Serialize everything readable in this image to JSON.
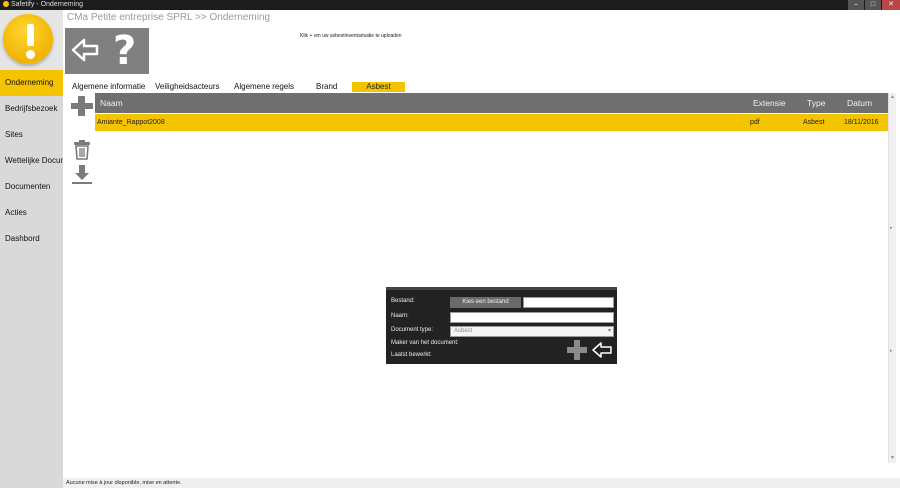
{
  "window": {
    "title": "Safetify - Onderneming"
  },
  "breadcrumb": "CMa Petite entreprise SPRL >> Onderneming",
  "hint": "Klik + om uw asbestinventarisatie te uploaden",
  "sidebar": {
    "items": [
      {
        "label": "Onderneming",
        "active": true
      },
      {
        "label": "Bedrijfsbezoek",
        "active": false
      },
      {
        "label": "Sites",
        "active": false
      },
      {
        "label": "Wettelijke Documenten",
        "active": false
      },
      {
        "label": "Documenten",
        "active": false
      },
      {
        "label": "Acties",
        "active": false
      },
      {
        "label": "Dashbord",
        "active": false
      }
    ]
  },
  "tabs": [
    {
      "label": "Algemene informatie",
      "active": false
    },
    {
      "label": "Veiligheidsacteurs",
      "active": false
    },
    {
      "label": "Algemene regels",
      "active": false
    },
    {
      "label": "Brand",
      "active": false
    },
    {
      "label": "Asbest",
      "active": true
    }
  ],
  "table": {
    "columns": [
      "Naam",
      "Extensie",
      "Type",
      "Datum"
    ],
    "rows": [
      {
        "naam": "Amiante_Rappot2008",
        "extensie": "pdf",
        "type": "Asbest",
        "datum": "18/11/2016"
      }
    ]
  },
  "dialog": {
    "bestand_label": "Bestand:",
    "kies_button": "Kies een bestand",
    "naam_label": "Naam:",
    "doctype_label": "Document type:",
    "doctype_value": "Asbest",
    "maker_label": "Maker van het document:",
    "laatst_label": "Laatst bewerkt:"
  },
  "status": "Aucune mise à jour disponible, mise en attente.",
  "colors": {
    "accent": "#f5c400",
    "header": "#6f6f6f",
    "sidebar": "#d9d9d9"
  },
  "icons": [
    "back-arrow-icon",
    "help-icon",
    "plus-icon",
    "trash-icon",
    "download-icon"
  ]
}
